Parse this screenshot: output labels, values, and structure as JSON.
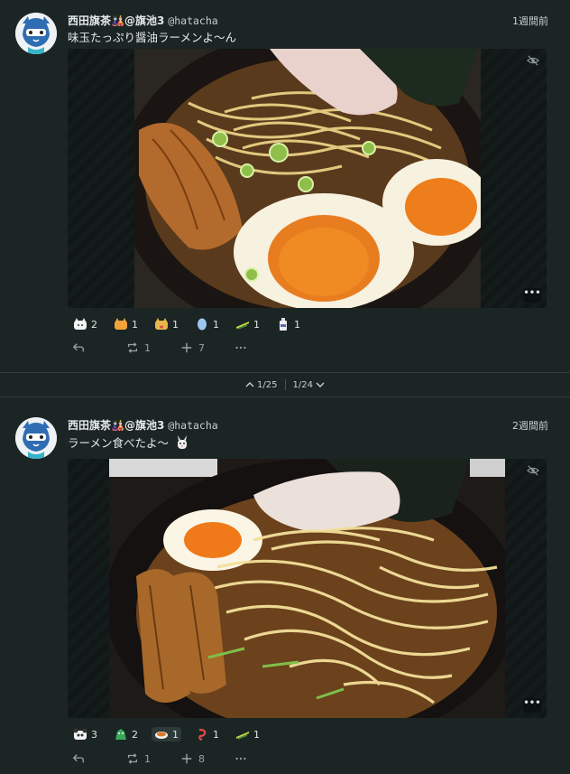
{
  "notes": [
    {
      "display_name": "西田旗茶🎎@旗池3",
      "username": "@hatacha",
      "time": "1週間前",
      "text": "味玉たっぷり醤油ラーメンよ〜ん",
      "media_alt": "ramen-photo-1",
      "reactions": [
        {
          "icon": "cat-emoji",
          "count": "2"
        },
        {
          "icon": "orange-cat-emoji",
          "count": "1"
        },
        {
          "icon": "tongue-cat-emoji",
          "count": "1"
        },
        {
          "icon": "egg-emoji",
          "count": "1"
        },
        {
          "icon": "chopsticks-emoji",
          "count": "1"
        },
        {
          "icon": "bottle-emoji",
          "count": "1"
        }
      ],
      "actions": {
        "reply": "",
        "renote": "1",
        "react": "7",
        "more": ""
      }
    },
    {
      "display_name": "西田旗茶🎎@旗池3",
      "username": "@hatacha",
      "time": "2週間前",
      "text": "ラーメン食べたよ〜",
      "media_alt": "ramen-photo-2",
      "reactions": [
        {
          "icon": "panda-emoji",
          "count": "3"
        },
        {
          "icon": "green-creature-emoji",
          "count": "2"
        },
        {
          "icon": "curry-emoji",
          "count": "1",
          "active": true
        },
        {
          "icon": "red-hook-emoji",
          "count": "1"
        },
        {
          "icon": "chopsticks-emoji",
          "count": "1"
        }
      ],
      "actions": {
        "reply": "",
        "renote": "1",
        "react": "8",
        "more": ""
      }
    }
  ],
  "pager": {
    "prev": "1/25",
    "next": "1/24"
  },
  "colors": {
    "background": "#1b2524",
    "text": "#dfe3e3",
    "muted": "#9aa3a3"
  }
}
